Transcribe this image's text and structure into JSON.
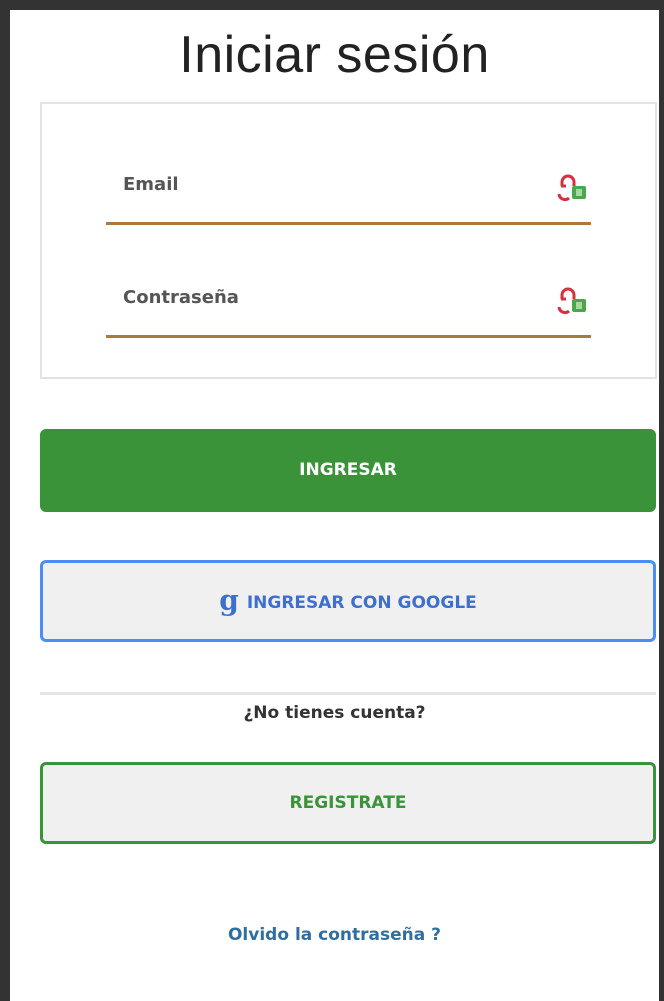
{
  "page": {
    "title": "Iniciar sesión"
  },
  "form": {
    "email": {
      "placeholder": "Email",
      "value": "",
      "icon": "password-manager-lock-icon"
    },
    "password": {
      "placeholder": "Contraseña",
      "value": "",
      "icon": "password-manager-lock-icon"
    }
  },
  "buttons": {
    "login": "INGRESAR",
    "google": "INGRESAR CON GOOGLE",
    "google_icon": "google-g-icon",
    "register": "REGISTRATE"
  },
  "links": {
    "no_account": "¿No tienes cuenta?",
    "forgot": "Olvido la contraseña ?"
  },
  "colors": {
    "primary_green": "#3a9339",
    "google_blue": "#4a8ef5",
    "field_underline": "#a97a3b",
    "link_blue": "#2f6f9f"
  }
}
